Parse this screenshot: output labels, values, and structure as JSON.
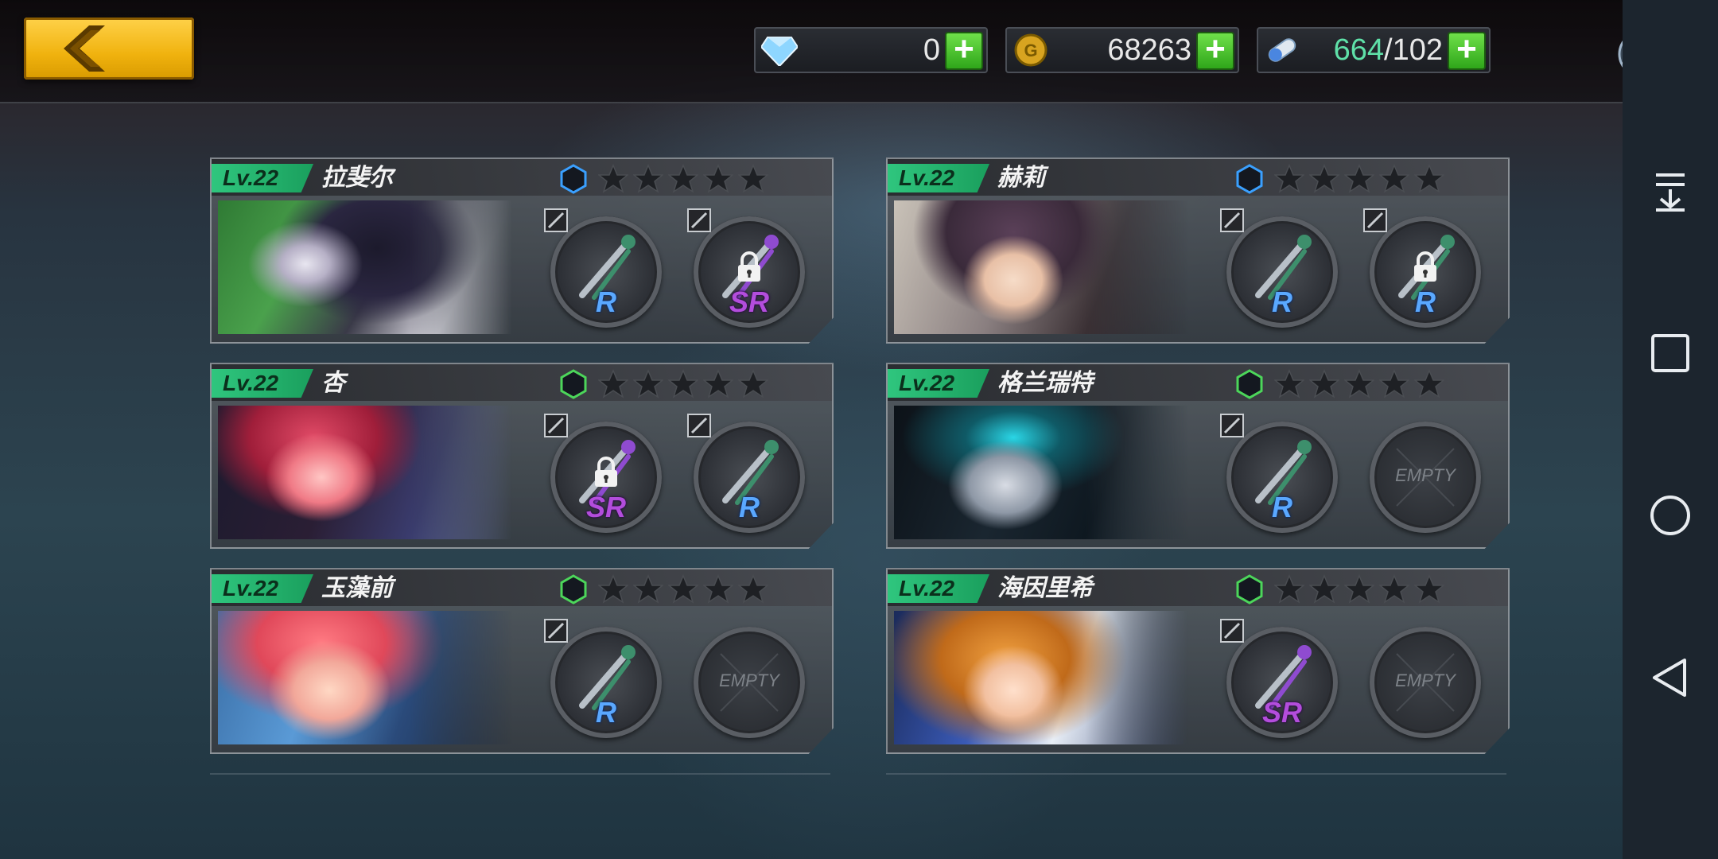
{
  "currencies": [
    {
      "id": "gems",
      "value": "0",
      "icon": "gem-icon"
    },
    {
      "id": "gold",
      "value": "68263",
      "icon": "gold-coin-icon"
    },
    {
      "id": "stamina",
      "value_current": "664",
      "value_max": "/102",
      "icon": "capsule-icon"
    }
  ],
  "cards": [
    {
      "level": "Lv.22",
      "name": "拉斐尔",
      "rank_color": "#3aa0ff",
      "slots": [
        {
          "rarity": "R",
          "locked": false,
          "empty": false
        },
        {
          "rarity": "SR",
          "locked": true,
          "empty": false
        }
      ]
    },
    {
      "level": "Lv.22",
      "name": "赫莉",
      "rank_color": "#3aa0ff",
      "slots": [
        {
          "rarity": "R",
          "locked": false,
          "empty": false
        },
        {
          "rarity": "R",
          "locked": true,
          "empty": false
        }
      ]
    },
    {
      "level": "Lv.22",
      "name": "杏",
      "rank_color": "#4cd65a",
      "slots": [
        {
          "rarity": "SR",
          "locked": true,
          "empty": false
        },
        {
          "rarity": "R",
          "locked": false,
          "empty": false
        }
      ]
    },
    {
      "level": "Lv.22",
      "name": "格兰瑞特",
      "rank_color": "#4cd65a",
      "slots": [
        {
          "rarity": "R",
          "locked": false,
          "empty": false
        },
        {
          "rarity": "",
          "locked": false,
          "empty": true,
          "empty_label": "EMPTY"
        }
      ]
    },
    {
      "level": "Lv.22",
      "name": "玉藻前",
      "rank_color": "#4cd65a",
      "slots": [
        {
          "rarity": "R",
          "locked": false,
          "empty": false
        },
        {
          "rarity": "",
          "locked": false,
          "empty": true,
          "empty_label": "EMPTY"
        }
      ]
    },
    {
      "level": "Lv.22",
      "name": "海因里希",
      "rank_color": "#4cd65a",
      "slots": [
        {
          "rarity": "SR",
          "locked": false,
          "empty": false
        },
        {
          "rarity": "",
          "locked": false,
          "empty": true,
          "empty_label": "EMPTY"
        }
      ]
    }
  ],
  "nav": [
    "collapse-icon",
    "recent-apps-icon",
    "home-icon",
    "back-icon"
  ]
}
